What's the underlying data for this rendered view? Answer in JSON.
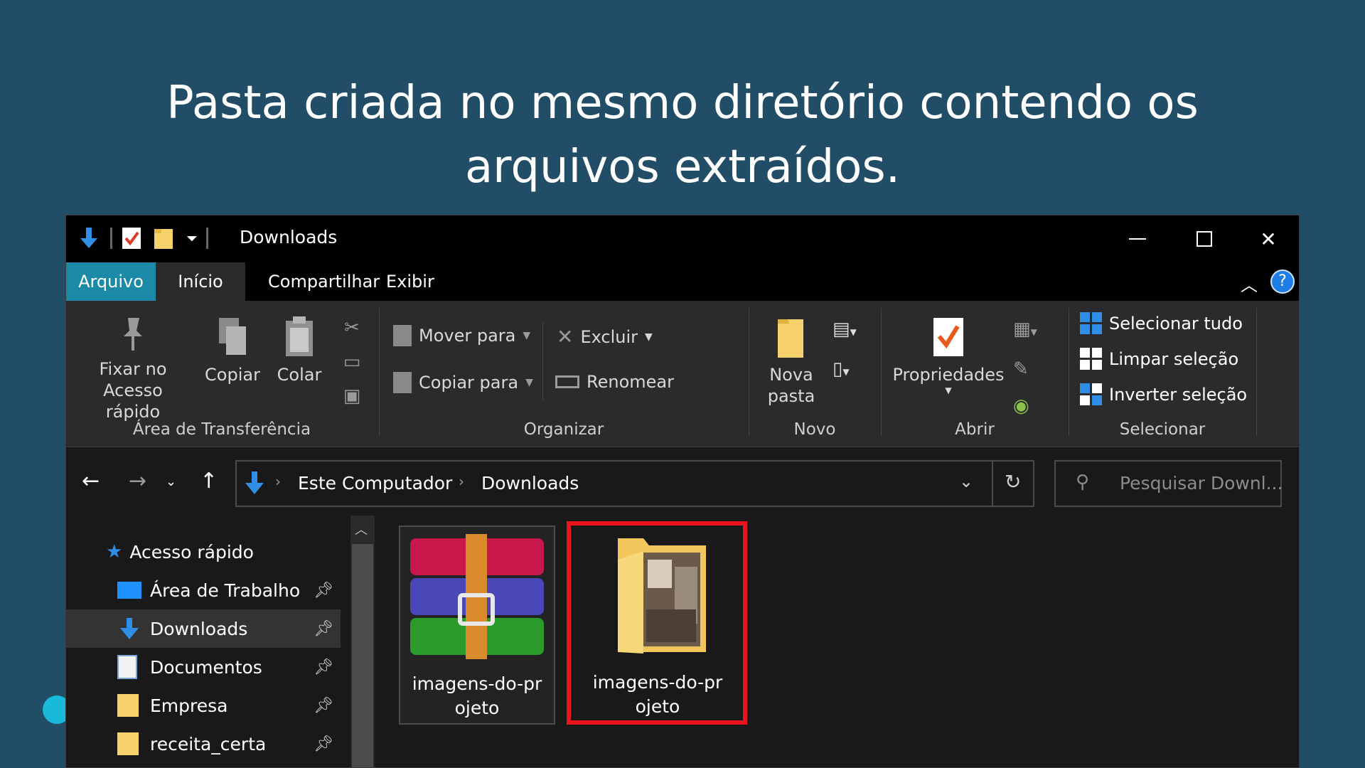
{
  "headline": {
    "line1": "Pasta criada no mesmo diretório contendo os",
    "line2": "arquivos extraídos."
  },
  "window": {
    "title": "Downloads",
    "tabs": [
      {
        "label": "Arquivo"
      },
      {
        "label": "Início"
      },
      {
        "label": "Compartilhar"
      },
      {
        "label": "Exibir"
      }
    ],
    "ribbon": {
      "pin_line1": "Fixar no",
      "pin_line2": "Acesso rápido",
      "copy": "Copiar",
      "paste": "Colar",
      "group_clipboard": "Área de Transferência",
      "move_to": "Mover para",
      "copy_to": "Copiar para",
      "delete": "Excluir",
      "rename": "Renomear",
      "group_organize": "Organizar",
      "new_folder_line1": "Nova",
      "new_folder_line2": "pasta",
      "group_new": "Novo",
      "properties": "Propriedades",
      "group_open": "Abrir",
      "select_all": "Selecionar tudo",
      "select_none": "Limpar seleção",
      "invert_selection": "Inverter seleção",
      "group_select": "Selecionar"
    },
    "address": {
      "crumbs": [
        "Este Computador",
        "Downloads"
      ]
    },
    "search": {
      "placeholder": "Pesquisar Downl..."
    },
    "nav_pane": [
      {
        "label": "Acesso rápido",
        "icon": "star-icon"
      },
      {
        "label": "Área de Trabalho",
        "icon": "desktop-icon",
        "pinned": true
      },
      {
        "label": "Downloads",
        "icon": "download-icon",
        "pinned": true,
        "selected": true
      },
      {
        "label": "Documentos",
        "icon": "document-icon",
        "pinned": true
      },
      {
        "label": "Empresa",
        "icon": "folder-icon",
        "pinned": true
      },
      {
        "label": "receita_certa",
        "icon": "folder-icon",
        "pinned": true
      }
    ],
    "files": [
      {
        "name_line1": "imagens-do-pr",
        "name_line2": "ojeto",
        "icon": "winrar-archive-icon"
      },
      {
        "name_line1": "imagens-do-pr",
        "name_line2": "ojeto",
        "icon": "image-folder-icon",
        "highlighted": true
      }
    ]
  },
  "colors": {
    "background": "#214e66",
    "file_tab": "#1a8aa6",
    "highlight": "#e8141e"
  }
}
